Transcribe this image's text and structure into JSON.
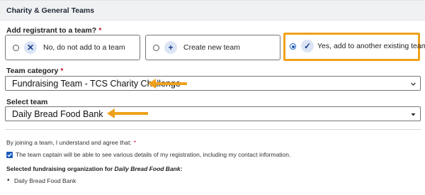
{
  "section": {
    "title": "Charity & General Teams"
  },
  "question": {
    "label": "Add registrant to a team?",
    "required_mark": "*"
  },
  "options": [
    {
      "label": "No, do not add to a team",
      "icon": "x-icon",
      "selected": false
    },
    {
      "label": "Create new team",
      "icon": "plus-icon",
      "selected": false
    },
    {
      "label": "Yes, add to another existing team",
      "icon": "check-icon",
      "selected": true
    }
  ],
  "team_category": {
    "label": "Team category",
    "required_mark": "*",
    "value": "Fundraising Team - TCS Charity Challenge"
  },
  "select_team": {
    "label": "Select team",
    "value": "Daily Bread Food Bank"
  },
  "agreement": {
    "label": "By joining a team, I understand and agree that:",
    "required_mark": "*",
    "checkbox_checked": true,
    "checkbox_text": "The team captain will be able to see various details of my registration, including my contact information."
  },
  "organization": {
    "heading_prefix": "Selected fundraising organization for ",
    "heading_team": "Daily Bread Food Bank",
    "heading_suffix": ":",
    "items": [
      "Daily Bread Food Bank"
    ]
  },
  "colors": {
    "highlight": "#f0a11b",
    "accent": "#1d5bbf",
    "required": "#c0122b",
    "icon_bg": "#dbe5f6"
  }
}
